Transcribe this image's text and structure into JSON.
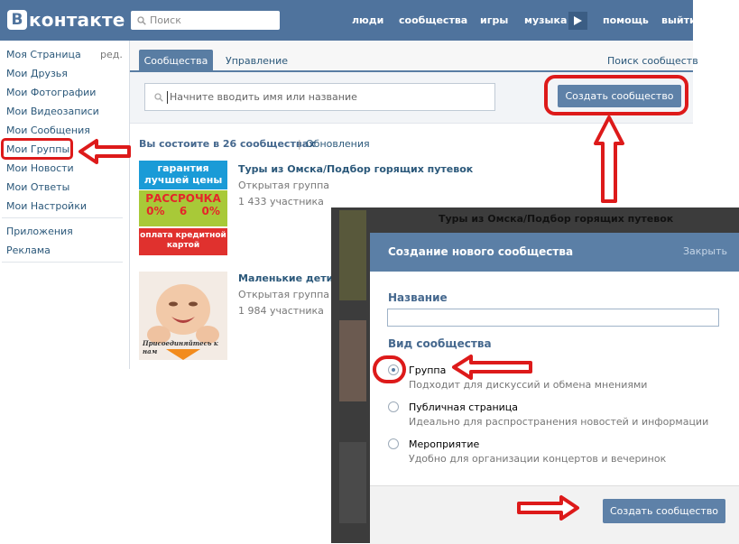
{
  "header": {
    "logo_text": "контакте",
    "logo_letter": "В",
    "search_placeholder": "Поиск",
    "nav": [
      "люди",
      "сообщества",
      "игры",
      "музыка",
      "помощь",
      "выйти"
    ]
  },
  "sidebar": {
    "edit_label": "ред.",
    "items": [
      "Моя Страница",
      "Мои Друзья",
      "Мои Фотографии",
      "Мои Видеозаписи",
      "Мои Сообщения",
      "Мои Группы",
      "Мои Новости",
      "Мои Ответы",
      "Мои Настройки"
    ],
    "extra": [
      "Приложения",
      "Реклама"
    ]
  },
  "tabs": {
    "groups": "Сообщества",
    "manage": "Управление",
    "search": "Поиск сообществ"
  },
  "search": {
    "placeholder": "Начните вводить имя или название",
    "create_button": "Создать сообщество"
  },
  "list": {
    "count_text": "Вы состоите в 26 сообществах",
    "updates": "Обновления",
    "groups": [
      {
        "name": "Туры из Омска/Подбор горящих путевок",
        "type": "Открытая группа",
        "members": "1 433 участника"
      },
      {
        "name": "Маленькие дети",
        "type": "Открытая группа",
        "members": "1 984 участника"
      }
    ]
  },
  "promo": {
    "line1": "гарантия",
    "line2": "лучшей цены",
    "line3": "РАССРОЧКА",
    "n1": "0%",
    "n2": "6",
    "n3": "0%",
    "line4": "оплата кредитной",
    "line5": "картой",
    "baby_caption": "Присоединяйтесь к нам"
  },
  "modal": {
    "title": "Создание нового сообщества",
    "close": "Закрыть",
    "name_label": "Название",
    "type_label": "Вид сообщества",
    "options": [
      {
        "title": "Группа",
        "desc": "Подходит для дискуссий и обмена мнениями",
        "selected": true
      },
      {
        "title": "Публичная страница",
        "desc": "Идеально для распространения новостей и информации",
        "selected": false
      },
      {
        "title": "Мероприятие",
        "desc": "Удобно для организации концертов и вечеринок",
        "selected": false
      }
    ],
    "create_button": "Создать сообщество"
  },
  "background_partial": {
    "text": "Туры из Омска/Подбор горящих путевок"
  },
  "colors": {
    "header_blue": "#4f739d",
    "link_blue": "#2b587a",
    "button_blue": "#5e81a8",
    "annotation_red": "#dd1a1a"
  }
}
